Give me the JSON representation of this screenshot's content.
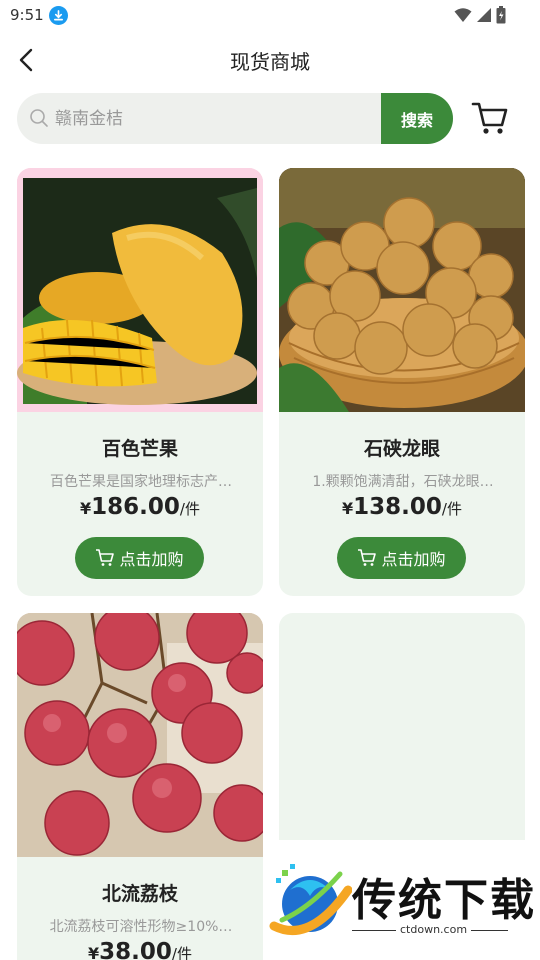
{
  "status_bar": {
    "time": "9:51",
    "icons": [
      "download-icon",
      "wifi-icon",
      "signal-icon",
      "battery-icon"
    ]
  },
  "nav": {
    "title": "现货商城",
    "back_icon": "back-arrow-icon"
  },
  "search": {
    "placeholder": "赣南金桔",
    "button_label": "搜索",
    "cart_icon": "cart-icon"
  },
  "products": [
    {
      "name": "百色芒果",
      "description": "百色芒果是国家地理标志产…",
      "currency": "¥",
      "price": "186.00",
      "unit": "/件",
      "button_label": "点击加购",
      "image": "mango-photo"
    },
    {
      "name": "石硖龙眼",
      "description": "1.颗颗饱满清甜，石硖龙眼…",
      "currency": "¥",
      "price": "138.00",
      "unit": "/件",
      "button_label": "点击加购",
      "image": "longan-photo"
    },
    {
      "name": "北流荔枝",
      "description": "北流荔枝可溶性形物≥10%…",
      "currency": "¥",
      "price": "38.00",
      "unit": "/件",
      "image": "lychee-photo"
    }
  ],
  "watermark": {
    "text": "传统下载",
    "url": "ctdown.com"
  },
  "colors": {
    "accent": "#3c8a3a",
    "card_bg": "#eef5ee",
    "search_bg": "#eef0ed",
    "status_download": "#1a9bf0"
  }
}
